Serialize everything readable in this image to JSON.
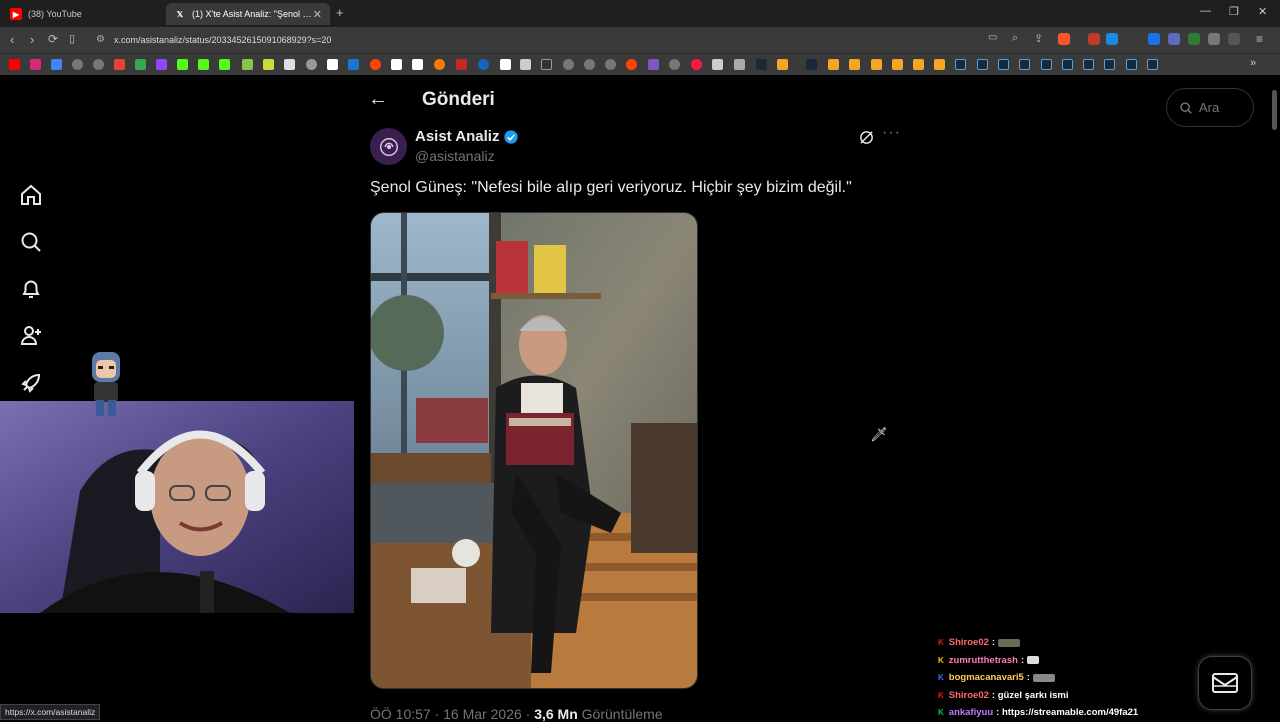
{
  "browser": {
    "tabs": [
      {
        "label": "(38) YouTube",
        "icon": "youtube-icon",
        "active": false
      },
      {
        "label": "(1) X'te Asist Analiz: \"Şenol Güne",
        "icon": "x-logo-icon",
        "active": true
      }
    ],
    "url": "x.com/asistanaliz/status/2033452615091068929?s=20",
    "status_url": "https://x.com/asistanaliz"
  },
  "page": {
    "title": "Gönderi",
    "search_placeholder": "Ara"
  },
  "sidebar": {
    "items": [
      {
        "name": "home",
        "icon": "home-icon"
      },
      {
        "name": "explore",
        "icon": "search-icon"
      },
      {
        "name": "notifications",
        "icon": "bell-icon"
      },
      {
        "name": "follow",
        "icon": "add-person-icon"
      },
      {
        "name": "premium",
        "icon": "rocket-icon"
      }
    ]
  },
  "tweet": {
    "author_name": "Asist Analiz",
    "author_handle": "@asistanaliz",
    "text": "Şenol Güneş: \"Nefesi bile alıp geri veriyoruz. Hiçbir şey bizim değil.\"",
    "time": "ÖÖ 10:57 · 16 Mar 2026 · ",
    "views": "3,6 Mn",
    "views_label": " Görüntüleme"
  },
  "chat": [
    {
      "user": "Shiroe02",
      "badge": "K",
      "badge_color": "#e91916",
      "user_color": "#ff6a6a",
      "text": ":",
      "emote": true
    },
    {
      "user": "zumrutthetrash",
      "badge": "K",
      "badge_color": "#f5c400",
      "user_color": "#ff7ab6",
      "text": ":",
      "emote": true
    },
    {
      "user": "bogmacanavari5",
      "badge": "K",
      "badge_color": "#3a6bff",
      "user_color": "#ffcf5a",
      "text": ":",
      "emote": true
    },
    {
      "user": "Shiroe02",
      "badge": "K",
      "badge_color": "#e91916",
      "user_color": "#ff6a6a",
      "text": ": güzel şarkı ismi",
      "emote": false
    },
    {
      "user": "ankafiyuu",
      "badge": "K",
      "badge_color": "#00c853",
      "user_color": "#c07bff",
      "text": ": https://streamable.com/49fa21",
      "emote": false
    }
  ],
  "colors": {
    "accent": "#1d9bf0",
    "background": "#000000",
    "muted": "#71767b"
  }
}
